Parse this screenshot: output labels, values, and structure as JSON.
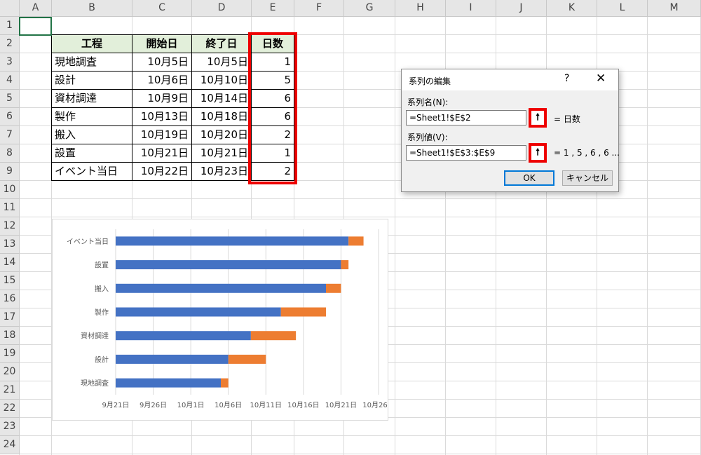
{
  "columns": [
    "A",
    "B",
    "C",
    "D",
    "E",
    "F",
    "G",
    "H",
    "I",
    "J",
    "K",
    "L",
    "M"
  ],
  "rows": [
    "1",
    "2",
    "3",
    "4",
    "5",
    "6",
    "7",
    "8",
    "9",
    "10",
    "11",
    "12",
    "13",
    "14",
    "15",
    "16",
    "17",
    "18",
    "19",
    "20",
    "21",
    "22",
    "23",
    "24"
  ],
  "table": {
    "headers": [
      "工程",
      "開始日",
      "終了日",
      "日数"
    ],
    "rows": [
      [
        "現地調査",
        "10月5日",
        "10月5日",
        "1"
      ],
      [
        "設計",
        "10月6日",
        "10月10日",
        "5"
      ],
      [
        "資材調達",
        "10月9日",
        "10月14日",
        "6"
      ],
      [
        "製作",
        "10月13日",
        "10月18日",
        "6"
      ],
      [
        "搬入",
        "10月19日",
        "10月20日",
        "2"
      ],
      [
        "設置",
        "10月21日",
        "10月21日",
        "1"
      ],
      [
        "イベント当日",
        "10月22日",
        "10月23日",
        "2"
      ]
    ]
  },
  "chart_data": {
    "type": "bar",
    "orientation": "horizontal-stacked",
    "categories": [
      "イベント当日",
      "設置",
      "搬入",
      "製作",
      "資材調達",
      "設計",
      "現地調査"
    ],
    "series": [
      {
        "values_start_offset_days": [
          31,
          30,
          28,
          22,
          18,
          15,
          14
        ],
        "color": "#4472c4"
      },
      {
        "values": [
          2,
          1,
          2,
          6,
          6,
          5,
          1
        ],
        "color": "#ed7d31"
      }
    ],
    "x_tick_labels": [
      "9月21日",
      "9月26日",
      "10月1日",
      "10月6日",
      "10月11日",
      "10月16日",
      "10月21日",
      "10月26日"
    ],
    "grid": true
  },
  "dialog": {
    "title": "系列の編集",
    "help": "?",
    "close": "✕",
    "name_label": "系列名(N):",
    "name_value": "=Sheet1!$E$2",
    "name_preview": "= 日数",
    "values_label": "系列値(V):",
    "values_value": "=Sheet1!$E$3:$E$9",
    "values_preview": "= 1 , 5 , 6 , 6 ...",
    "collapse_glyph": "🠕",
    "ok": "OK",
    "cancel": "キャンセル"
  }
}
